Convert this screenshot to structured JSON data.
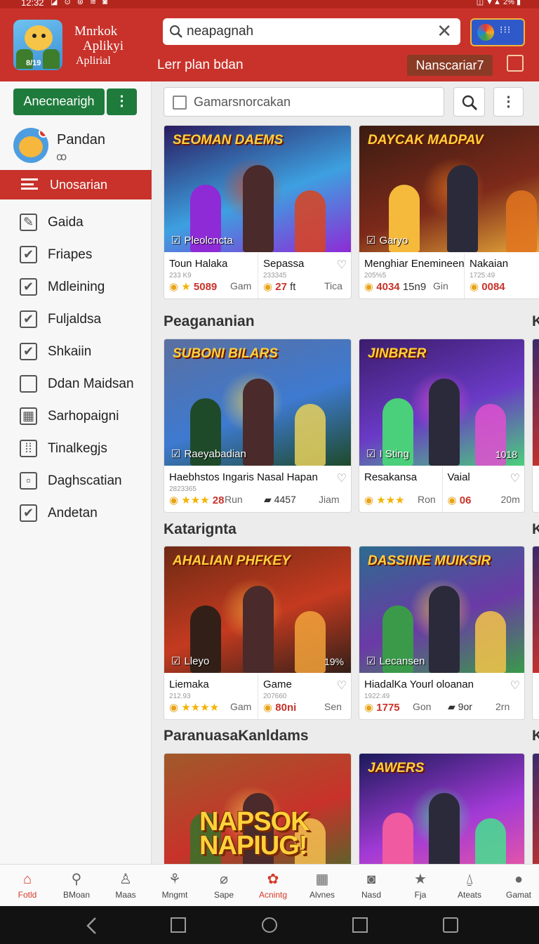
{
  "status_bar": {
    "time": "12:32",
    "icons": "◪ ⊙ ⊛ ≋ ◙",
    "right": "◫ ▼▲ 2% ▮"
  },
  "header": {
    "app_name_line1": "Mnrkok",
    "app_name_line2": "Aplikyi",
    "app_name_line3": "Aplirial",
    "logo_badge": "8/19",
    "search_value": "neapagnah",
    "subtitle": "Lerr plan bdan",
    "nav_chip": "Nanscariar7"
  },
  "sidebar": {
    "action_button": "Anecnearigh",
    "user_name": "Pandan",
    "user_status": "ꝏ",
    "active_item": "Unosarian",
    "items": [
      {
        "label": "Gaida",
        "icon": "wrench-icon",
        "glyph": "✎"
      },
      {
        "label": "Friapes",
        "icon": "checkbox-icon",
        "glyph": "✔"
      },
      {
        "label": "Mdleining",
        "icon": "checkbox-icon",
        "glyph": "✔"
      },
      {
        "label": "Fuljaldsa",
        "icon": "checkbox-icon",
        "glyph": "✔"
      },
      {
        "label": "Shkaiin",
        "icon": "checkbox-icon",
        "glyph": "✔"
      },
      {
        "label": "Ddan Maidsan",
        "icon": "square-icon",
        "glyph": ""
      },
      {
        "label": "Sarhopaigni",
        "icon": "grid-icon",
        "glyph": "▦"
      },
      {
        "label": "Tinalkegjs",
        "icon": "bars-icon",
        "glyph": "⁞⁞"
      },
      {
        "label": "Daghscatian",
        "icon": "box-icon",
        "glyph": "▫"
      },
      {
        "label": "Andetan",
        "icon": "checkbox-icon",
        "glyph": "✔"
      }
    ]
  },
  "filter": {
    "placeholder": "Gamarsnorcakan"
  },
  "sections": [
    {
      "title": "",
      "cards": [
        {
          "logo": "SEOMAN DAEMS",
          "tag": "Pleolcncta",
          "pct": "",
          "subs": [
            {
              "name": "Toun Halaka",
              "code": "233 K9",
              "val": "5089",
              "stars": "★",
              "game": "Gam"
            },
            {
              "name": "Sepassa",
              "code": "233345",
              "val": "27",
              "unit": "ft",
              "game": "Tica",
              "heart": true
            }
          ]
        },
        {
          "logo": "DAYCAK MADPAV",
          "tag": "Garyo",
          "pct": "",
          "subs": [
            {
              "name": "Menghiar Enemineen",
              "code": "205%5",
              "val": "4034",
              "unit": "15n9",
              "game": "Gin"
            },
            {
              "name": "Nakaian",
              "code": "1725:49",
              "val": "0084",
              "game": ""
            }
          ]
        }
      ]
    },
    {
      "title": "Peagananian",
      "cards": [
        {
          "logo": "SUBONI BILARS",
          "tag": "Raeyabadian",
          "pct": "",
          "subs": [
            {
              "name": "Haebhstos Ingaris Nasal Hapan",
              "code": "2823365",
              "val": "28",
              "stars": "★★★",
              "game": "Run",
              "extra": "4457",
              "extra_game": "Jiam",
              "heart": true
            }
          ]
        },
        {
          "logo": "JINBRER",
          "tag": "I Sting",
          "pct": "1018",
          "subs": [
            {
              "name": "Resakansa",
              "code": "",
              "val": "",
              "stars": "★★★",
              "game": "Ron"
            },
            {
              "name": "Vaial",
              "code": "",
              "val": "06",
              "game": "20m",
              "heart": true
            }
          ]
        }
      ]
    },
    {
      "title": "Katarignta",
      "cards": [
        {
          "logo": "AHALIAN PHFKEY",
          "tag": "Lleyo",
          "pct": "19%",
          "subs": [
            {
              "name": "Liemaka",
              "code": "212.93",
              "val": "",
              "stars": "★★★★",
              "game": "Gam"
            },
            {
              "name": "Game",
              "code": "207660",
              "val": "80ni",
              "game": "Sen",
              "heart": true
            }
          ]
        },
        {
          "logo": "DASSIINE MUIKSIR",
          "tag": "Lecansen",
          "pct": "",
          "subs": [
            {
              "name": "HiadalKa Yourl oloanan",
              "code": "1922:49",
              "val": "1775",
              "game": "Gon",
              "extra": "9or",
              "extra_game": "2rn",
              "heart": true
            }
          ]
        }
      ]
    },
    {
      "title": "ParanuasaKanldams",
      "cards": [
        {
          "logo": "",
          "big": "NAPSOK NAPIUG!",
          "tag": "",
          "pct": "",
          "subs": []
        },
        {
          "logo": "JAWERS",
          "tag": "",
          "pct": "",
          "subs": []
        }
      ]
    }
  ],
  "right_peek": "K",
  "bottom_nav": [
    {
      "label": "Fotld",
      "icon": "home-icon",
      "glyph": "⌂",
      "active": true
    },
    {
      "label": "BMoan",
      "icon": "search-icon",
      "glyph": "⚲"
    },
    {
      "label": "Maas",
      "icon": "person-icon",
      "glyph": "♙"
    },
    {
      "label": "Mngmt",
      "icon": "basket-icon",
      "glyph": "⚘"
    },
    {
      "label": "Sape",
      "icon": "tag-icon",
      "glyph": "⌀"
    },
    {
      "label": "Acnintg",
      "icon": "gamepad-icon",
      "glyph": "✿",
      "active": true
    },
    {
      "label": "Alvnes",
      "icon": "calendar-icon",
      "glyph": "▦"
    },
    {
      "label": "Nasd",
      "icon": "controller-icon",
      "glyph": "◙"
    },
    {
      "label": "Fja",
      "icon": "star-icon",
      "glyph": "★"
    },
    {
      "label": "Ateats",
      "icon": "bell-icon",
      "glyph": "⍙"
    },
    {
      "label": "Gamat",
      "icon": "account-icon",
      "glyph": "●"
    }
  ],
  "colors": {
    "accent": "#c8322a",
    "green": "#1e7b3c",
    "star": "#f3b300"
  }
}
